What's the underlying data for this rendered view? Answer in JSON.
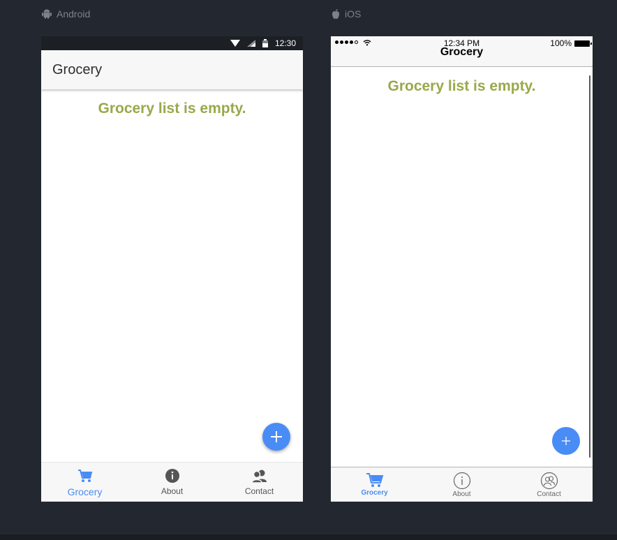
{
  "platforms": {
    "android": {
      "label": "Android"
    },
    "ios": {
      "label": "iOS"
    }
  },
  "android": {
    "status_time": "12:30",
    "title": "Grocery",
    "empty_message": "Grocery list is empty.",
    "fab_icon": "plus-icon",
    "tabs": [
      {
        "label": "Grocery",
        "icon": "cart-icon",
        "active": true
      },
      {
        "label": "About",
        "icon": "info-icon",
        "active": false
      },
      {
        "label": "Contact",
        "icon": "contacts-icon",
        "active": false
      }
    ]
  },
  "ios": {
    "status_time": "12:34 PM",
    "battery": "100%",
    "title": "Grocery",
    "empty_message": "Grocery list is empty.",
    "fab_icon": "plus-icon",
    "tabs": [
      {
        "label": "Grocery",
        "icon": "cart-icon",
        "active": true
      },
      {
        "label": "About",
        "icon": "info-icon",
        "active": false
      },
      {
        "label": "Contact",
        "icon": "contacts-icon",
        "active": false
      }
    ]
  },
  "colors": {
    "background": "#232830",
    "accent": "#4a8cf5",
    "empty_text": "#9aa84a"
  }
}
